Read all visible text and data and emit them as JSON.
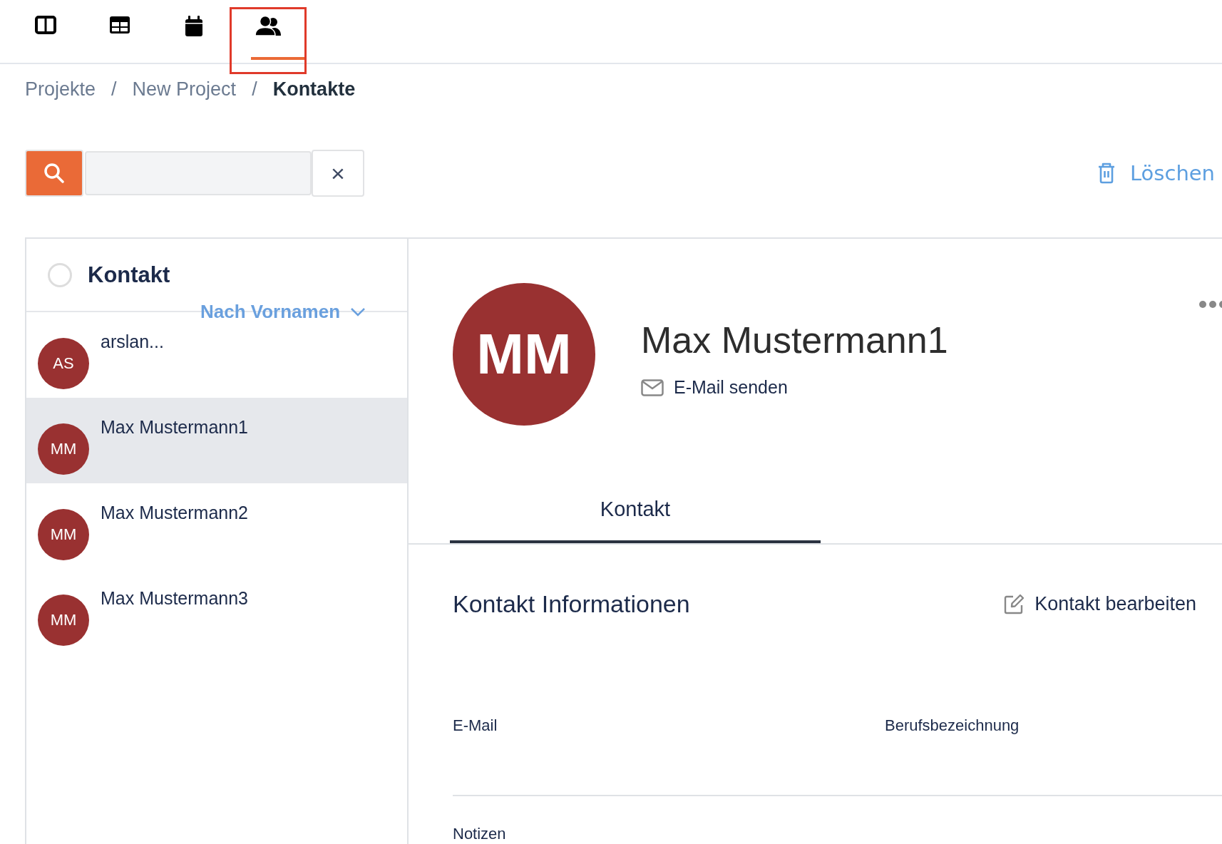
{
  "nav_tabs": [
    {
      "kind": "columns",
      "selected": false
    },
    {
      "kind": "table",
      "selected": false
    },
    {
      "kind": "calendar",
      "selected": false
    },
    {
      "kind": "people",
      "selected": true
    }
  ],
  "breadcrumb": [
    {
      "label": "Projekte",
      "current": false
    },
    {
      "label": "New Project",
      "current": false
    },
    {
      "label": "Kontakte",
      "current": true
    }
  ],
  "breadcrumb_separator": "/",
  "search": {
    "clear_label": "×"
  },
  "delete_label": "Löschen",
  "list": {
    "header": "Kontakt",
    "select_all_checked": false,
    "sort_label": "Nach Vornamen",
    "contacts": [
      {
        "initials": "AS",
        "name": "arslan...",
        "selected": false
      },
      {
        "initials": "MM",
        "name": "Max Mustermann1",
        "selected": true
      },
      {
        "initials": "MM",
        "name": "Max Mustermann2",
        "selected": false
      },
      {
        "initials": "MM",
        "name": "Max Mustermann3",
        "selected": false
      }
    ]
  },
  "detail": {
    "initials": "MM",
    "name": "Max Mustermann1",
    "email_action": "E-Mail senden",
    "tabs": [
      {
        "label": "Kontakt",
        "selected": true
      }
    ],
    "section_title": "Kontakt Informationen",
    "edit_label": "Kontakt bearbeiten",
    "fields": [
      "E-Mail",
      "Berufsbezeichnung"
    ],
    "notes_label": "Notizen"
  }
}
